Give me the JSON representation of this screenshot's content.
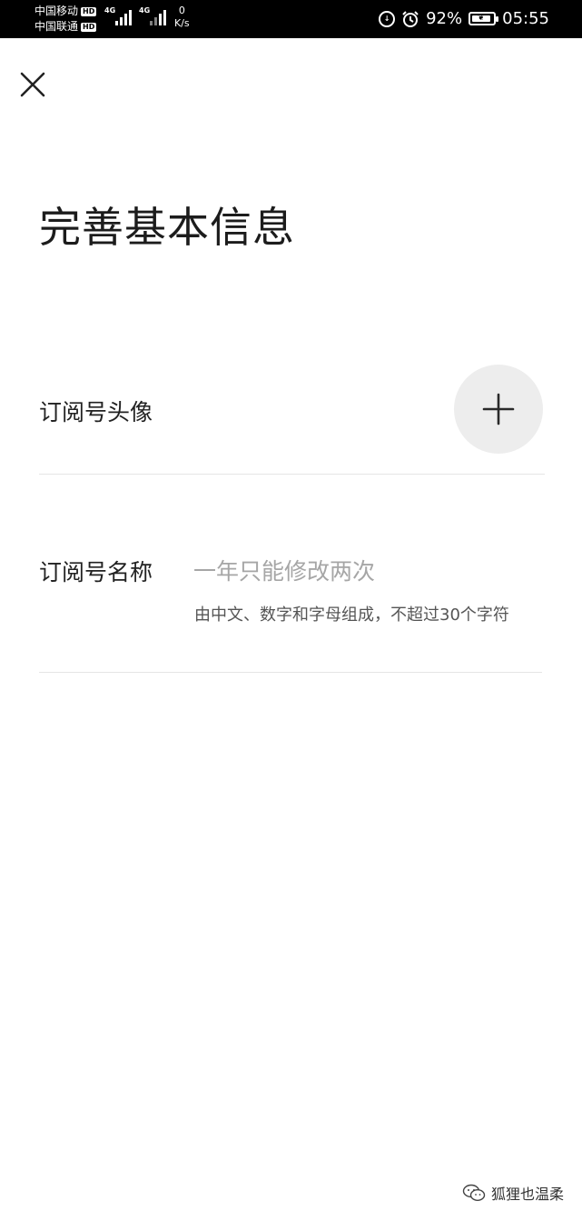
{
  "status_bar": {
    "carrier_1": "中国移动",
    "carrier_2": "中国联通",
    "hd_badge": "HD",
    "network_1": "4G",
    "network_2": "4G",
    "speed_value": "0",
    "speed_unit": "K/s",
    "battery_percent": "92%",
    "battery_level": 0.92,
    "time": "05:55",
    "icons": [
      "hd-icon",
      "signal-icon",
      "signal-icon",
      "data-saver-icon",
      "alarm-icon",
      "battery-icon"
    ]
  },
  "header": {
    "close_icon": "close-icon",
    "title": "完善基本信息"
  },
  "form": {
    "avatar": {
      "label": "订阅号头像",
      "add_icon": "plus-icon"
    },
    "name": {
      "label": "订阅号名称",
      "placeholder": "一年只能修改两次",
      "value": "",
      "hint": "由中文、数字和字母组成，不超过30个字符"
    }
  },
  "watermark": {
    "icon": "wechat-icon",
    "text": "狐狸也温柔"
  },
  "colors": {
    "status_bar_bg": "#000000",
    "background": "#ffffff",
    "placeholder": "#a6a6a6",
    "divider": "#e5e5e5",
    "avatar_circle": "#ededed"
  }
}
